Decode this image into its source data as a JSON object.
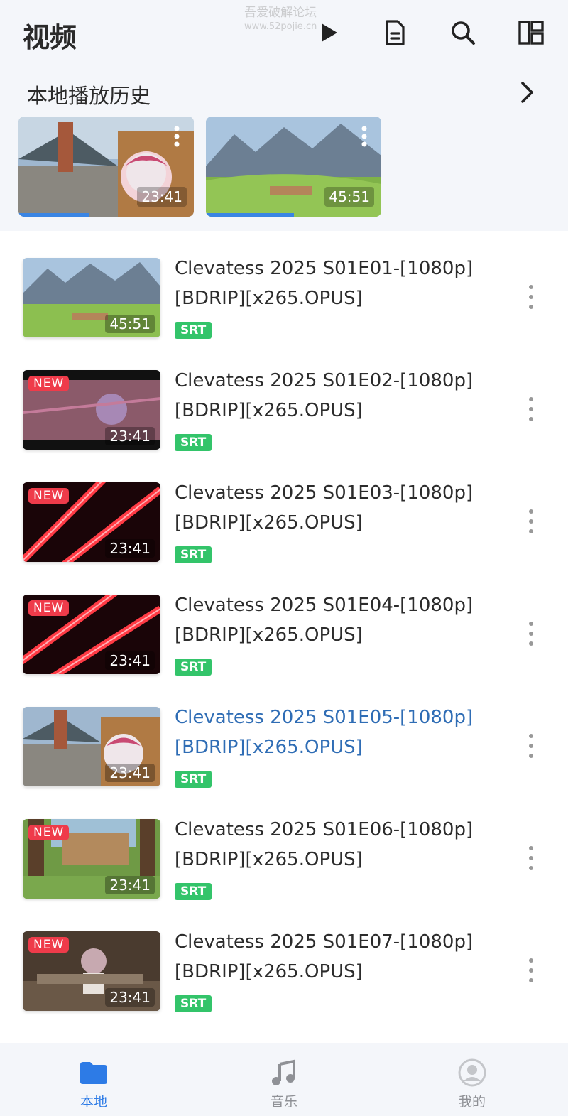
{
  "header": {
    "title": "视频",
    "watermark_line1": "吾爱破解论坛",
    "watermark_line2": "www.52pojie.cn",
    "icons": [
      "play-icon",
      "document-icon",
      "search-icon",
      "layout-icon"
    ]
  },
  "history": {
    "title": "本地播放历史",
    "items": [
      {
        "duration": "23:41",
        "progress": 0.4
      },
      {
        "duration": "45:51",
        "progress": 0.5
      }
    ]
  },
  "videos": [
    {
      "title": "Clevatess 2025 S01E01-[1080p][BDRIP][x265.OPUS]",
      "duration": "45:51",
      "new": false,
      "badge": "SRT",
      "active": false
    },
    {
      "title": "Clevatess 2025 S01E02-[1080p][BDRIP][x265.OPUS]",
      "duration": "23:41",
      "new": true,
      "new_label": "NEW",
      "badge": "SRT",
      "active": false
    },
    {
      "title": "Clevatess 2025 S01E03-[1080p][BDRIP][x265.OPUS]",
      "duration": "23:41",
      "new": true,
      "new_label": "NEW",
      "badge": "SRT",
      "active": false
    },
    {
      "title": "Clevatess 2025 S01E04-[1080p][BDRIP][x265.OPUS]",
      "duration": "23:41",
      "new": true,
      "new_label": "NEW",
      "badge": "SRT",
      "active": false
    },
    {
      "title": "Clevatess 2025 S01E05-[1080p][BDRIP][x265.OPUS]",
      "duration": "23:41",
      "new": false,
      "badge": "SRT",
      "active": true
    },
    {
      "title": "Clevatess 2025 S01E06-[1080p][BDRIP][x265.OPUS]",
      "duration": "23:41",
      "new": true,
      "new_label": "NEW",
      "badge": "SRT",
      "active": false
    },
    {
      "title": "Clevatess 2025 S01E07-[1080p][BDRIP][x265.OPUS]",
      "duration": "23:41",
      "new": true,
      "new_label": "NEW",
      "badge": "SRT",
      "active": false
    }
  ],
  "nav": {
    "items": [
      {
        "label": "本地",
        "icon": "folder-icon",
        "active": true
      },
      {
        "label": "音乐",
        "icon": "music-icon",
        "active": false
      },
      {
        "label": "我的",
        "icon": "profile-icon",
        "active": false
      }
    ]
  },
  "colors": {
    "accent": "#2d7be6",
    "active_title": "#2f6db5",
    "new_badge": "#ef3b4a",
    "srt_badge": "#33c46a"
  }
}
